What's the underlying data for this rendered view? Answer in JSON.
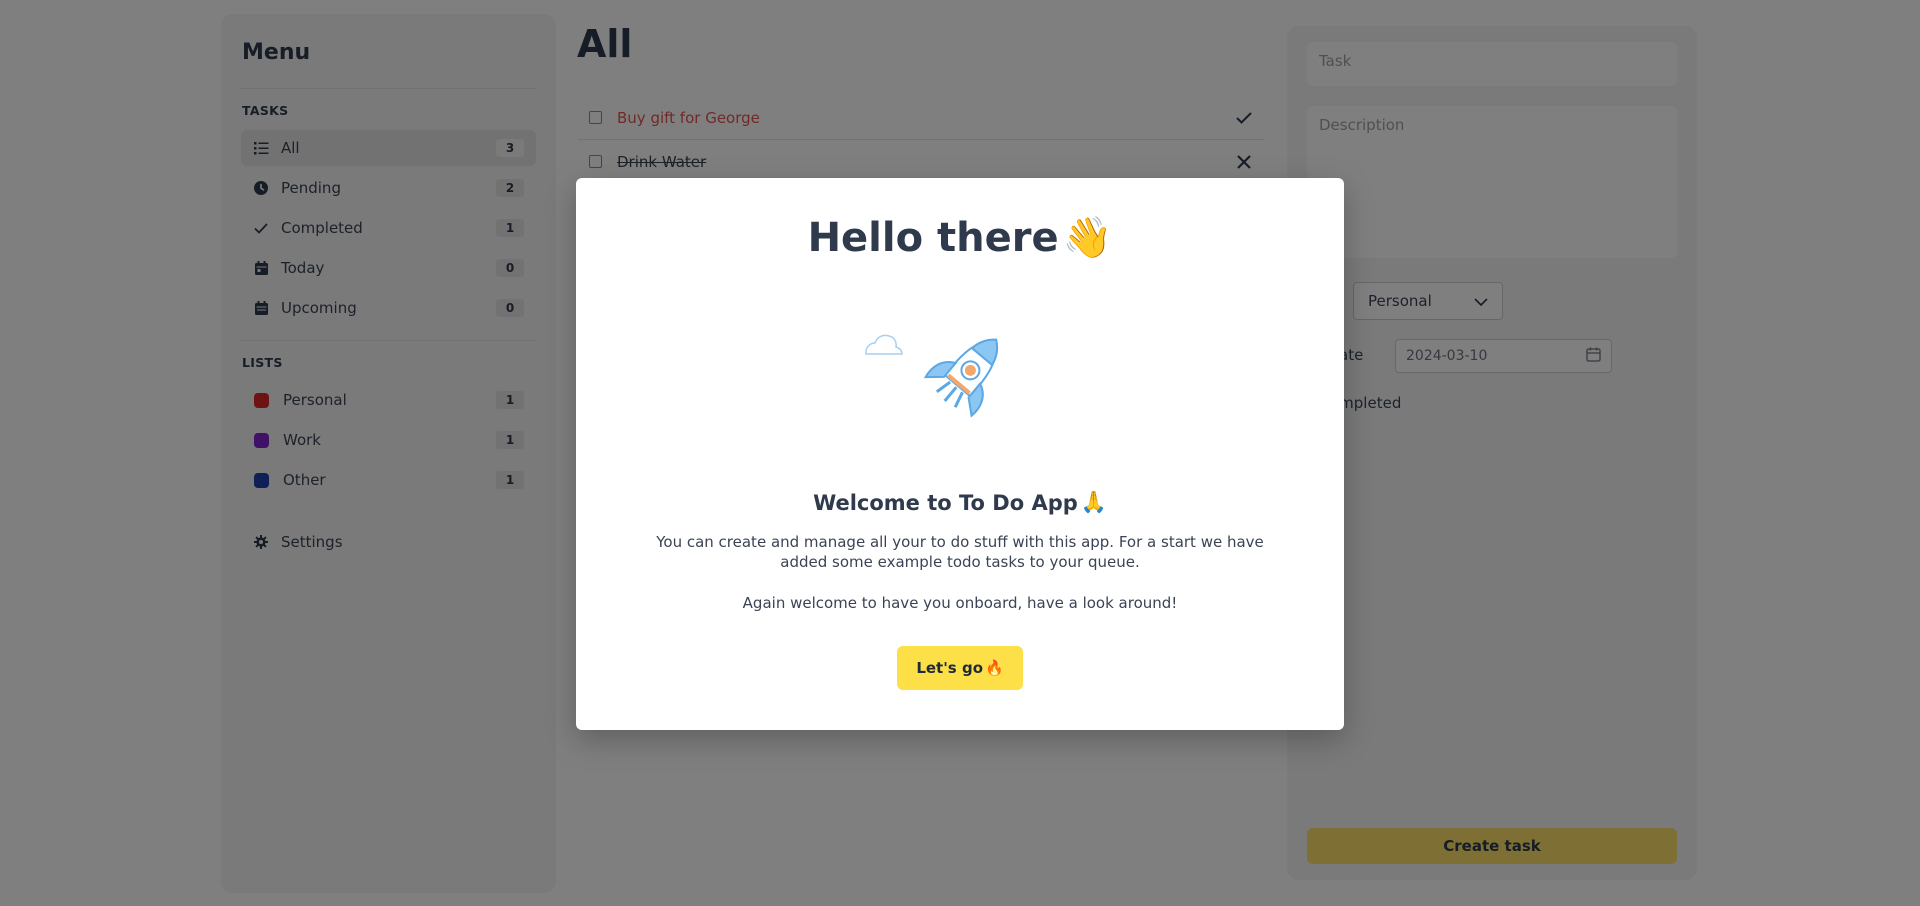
{
  "sidebar": {
    "title": "Menu",
    "tasks_label": "TASKS",
    "tasks": [
      {
        "label": "All",
        "count": "3",
        "icon": "list-icon"
      },
      {
        "label": "Pending",
        "count": "2",
        "icon": "clock-icon"
      },
      {
        "label": "Completed",
        "count": "1",
        "icon": "check-icon"
      },
      {
        "label": "Today",
        "count": "0",
        "icon": "calendar-icon"
      },
      {
        "label": "Upcoming",
        "count": "0",
        "icon": "calendar-icon"
      }
    ],
    "lists_label": "LISTS",
    "lists": [
      {
        "label": "Personal",
        "count": "1",
        "color": "#dc2626"
      },
      {
        "label": "Work",
        "count": "1",
        "color": "#7e22ce"
      },
      {
        "label": "Other",
        "count": "1",
        "color": "#1e40af"
      }
    ],
    "settings_label": "Settings"
  },
  "main": {
    "title": "All",
    "tasks": [
      {
        "text": "Buy gift for George",
        "status": "pending"
      },
      {
        "text": "Drink Water",
        "status": "completed"
      }
    ]
  },
  "form": {
    "task_placeholder": "Task",
    "description_placeholder": "Description",
    "list_value": "Personal",
    "date_label_fragment": "ate",
    "date_value": "2024-03-10",
    "completed_label_fragment": "ompleted",
    "create_button": "Create task"
  },
  "modal": {
    "title": "Hello there",
    "title_emoji": "👋",
    "welcome": "Welcome to To Do App",
    "welcome_emoji": "🙏",
    "body": "You can create and manage all your to do stuff with this app. For a start we have added some example todo tasks to your queue.",
    "body2": "Again welcome to have you onboard, have a look around!",
    "button": "Let's go",
    "button_emoji": "🔥"
  },
  "colors": {
    "accent": "#fde047",
    "overdue": "#e25252",
    "overlay": "rgba(0,0,0,0.5)"
  }
}
